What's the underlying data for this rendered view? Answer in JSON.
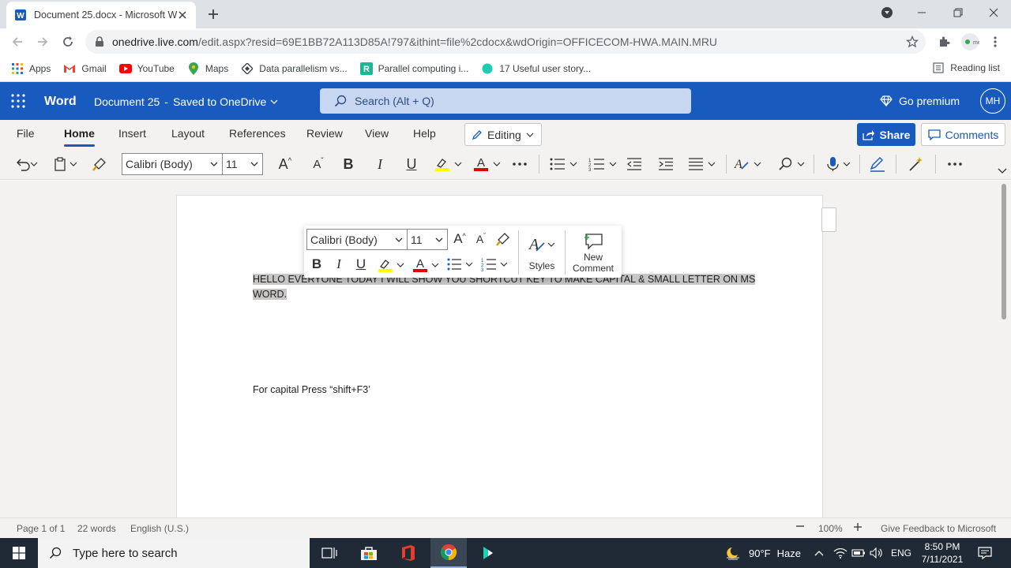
{
  "browser": {
    "tab_title": "Document 25.docx - Microsoft W",
    "url_domain": "onedrive.live.com",
    "url_path": "/edit.aspx?resid=69E1BB72A113D85A!797&ithint=file%2cdocx&wdOrigin=OFFICECOM-HWA.MAIN.MRU",
    "bookmarks": [
      {
        "label": "Apps",
        "icon": "apps-grid-icon"
      },
      {
        "label": "Gmail",
        "icon": "gmail-icon"
      },
      {
        "label": "YouTube",
        "icon": "youtube-icon"
      },
      {
        "label": "Maps",
        "icon": "maps-pin-icon"
      },
      {
        "label": "Data parallelism vs...",
        "icon": "diamond-icon"
      },
      {
        "label": "Parallel computing i...",
        "icon": "r-logo-icon"
      },
      {
        "label": "17 Useful user story...",
        "icon": "teal-dot-icon"
      }
    ],
    "reading_list": "Reading list"
  },
  "word": {
    "app_name": "Word",
    "doc_name": "Document 25",
    "doc_status": "Saved to OneDrive",
    "search_placeholder": "Search (Alt + Q)",
    "go_premium": "Go premium",
    "user_initials": "MH",
    "colors": {
      "brand": "#185abd",
      "highlight": "#ffff00",
      "font_color": "#e00000"
    }
  },
  "ribbon": {
    "tabs": [
      {
        "label": "File",
        "active": false
      },
      {
        "label": "Home",
        "active": true
      },
      {
        "label": "Insert",
        "active": false
      },
      {
        "label": "Layout",
        "active": false
      },
      {
        "label": "References",
        "active": false
      },
      {
        "label": "Review",
        "active": false
      },
      {
        "label": "View",
        "active": false
      },
      {
        "label": "Help",
        "active": false
      }
    ],
    "mode": "Editing",
    "share": "Share",
    "comments": "Comments"
  },
  "toolbar": {
    "font_name": "Calibri (Body)",
    "font_size": "11",
    "grow_font": "A",
    "shrink_font": "A",
    "bold": "B",
    "italic": "I",
    "underline": "U",
    "font_color_letter": "A"
  },
  "mini_toolbar": {
    "font_name": "Calibri (Body)",
    "font_size": "11",
    "styles_label": "Styles",
    "new_comment_line1": "New",
    "new_comment_line2": "Comment"
  },
  "document": {
    "paragraphs": [
      "HELLO EVERYONE TODAY I WILL SHOW YOU SHORTCUT KEY TO MAKE CAPITAL & SMALL LETTER ON MS WORD.",
      "For capital Press “shift+F3’"
    ]
  },
  "status": {
    "page": "Page 1 of 1",
    "words": "22 words",
    "language": "English (U.S.)",
    "zoom": "100%",
    "feedback": "Give Feedback to Microsoft"
  },
  "taskbar": {
    "search_placeholder": "Type here to search",
    "weather_temp": "90°F",
    "weather_desc": "Haze",
    "language": "ENG",
    "time": "8:50 PM",
    "date": "7/11/2021"
  }
}
